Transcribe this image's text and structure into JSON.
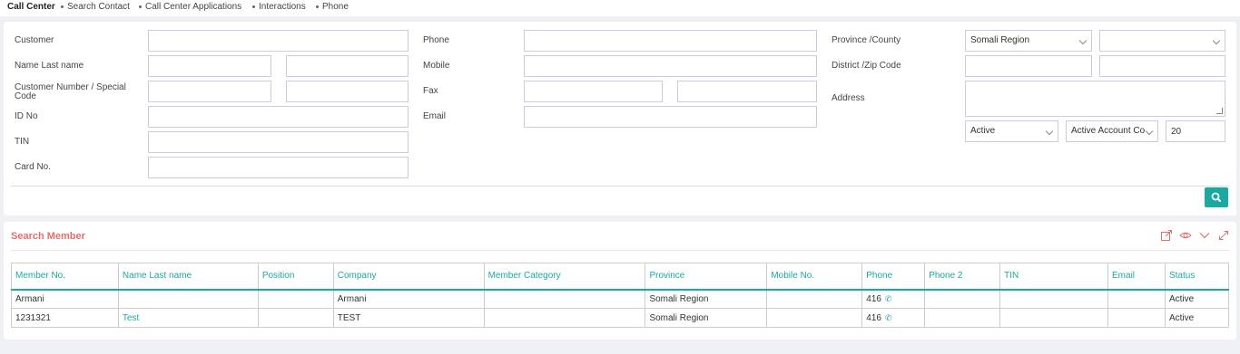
{
  "breadcrumb": [
    "Call Center",
    "Search Contact",
    "Call Center Applications",
    "Interactions",
    "Phone"
  ],
  "form": {
    "labels": {
      "customer": "Customer",
      "name_last_name": "Name Last name",
      "customer_number_line1": "Customer Number / Special",
      "customer_number_line2": "Code",
      "id_no": "ID No",
      "tin": "TIN",
      "card_no": "Card No.",
      "phone": "Phone",
      "mobile": "Mobile",
      "fax": "Fax",
      "email": "Email",
      "province": "Province /County",
      "district": "District /Zip Code",
      "address": "Address"
    },
    "province_value": "Somali Region",
    "county_value": "",
    "status_value": "Active",
    "account_value": "Active Account Co",
    "page_size_value": "20",
    "search_icon": "search-icon"
  },
  "results": {
    "title": "Search Member",
    "toolbar_icons": [
      "export-icon",
      "eye-icon",
      "chevron-down-icon",
      "expand-icon"
    ],
    "columns": [
      "Member No.",
      "Name Last name",
      "Position",
      "Company",
      "Member Category",
      "Province",
      "Mobile No.",
      "Phone",
      "Phone 2",
      "TIN",
      "Email",
      "Status"
    ],
    "rows": [
      [
        "Armani",
        "",
        "",
        "Armani",
        "",
        "Somali Region",
        "",
        "416",
        "",
        "",
        "",
        "Active"
      ],
      [
        "1231321",
        "Test",
        "",
        "TEST",
        "",
        "Somali Region",
        "",
        "416",
        "",
        "",
        "",
        "Active"
      ]
    ]
  },
  "colors": {
    "accent": "#1aa9a0",
    "title": "#e07070"
  }
}
